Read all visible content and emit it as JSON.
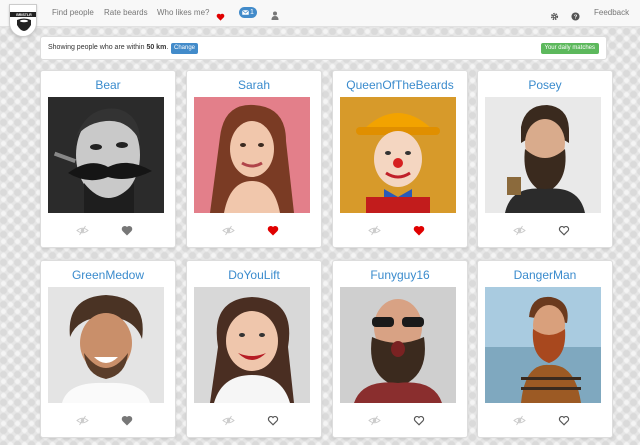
{
  "nav": {
    "logo_text": "BRISTLR",
    "links": [
      "Find people",
      "Rate beards",
      "Who likes me?"
    ],
    "badge_count": "1",
    "feedback": "Feedback"
  },
  "info": {
    "text_prefix": "Showing people who are within ",
    "distance": "50 km",
    "text_suffix": ".",
    "change_label": "Change",
    "matches_label": "Your daily matches"
  },
  "colors": {
    "accent": "#428bca",
    "name": "#3a8bcd",
    "success": "#5cb85c",
    "liked": "#e00000"
  },
  "profiles": [
    {
      "name": "Bear",
      "liked": false,
      "like_icon": "heart-filled-gray-icon"
    },
    {
      "name": "Sarah",
      "liked": true,
      "like_icon": "heart-filled-red-icon"
    },
    {
      "name": "QueenOfTheBeards",
      "liked": true,
      "like_icon": "heart-filled-red-icon"
    },
    {
      "name": "Posey",
      "liked": false,
      "like_icon": "heart-outline-icon"
    },
    {
      "name": "GreenMedow",
      "liked": false,
      "like_icon": "heart-filled-gray-icon"
    },
    {
      "name": "DoYouLift",
      "liked": false,
      "like_icon": "heart-outline-icon"
    },
    {
      "name": "Funyguy16",
      "liked": false,
      "like_icon": "heart-outline-icon"
    },
    {
      "name": "DangerMan",
      "liked": false,
      "like_icon": "heart-outline-icon"
    }
  ]
}
